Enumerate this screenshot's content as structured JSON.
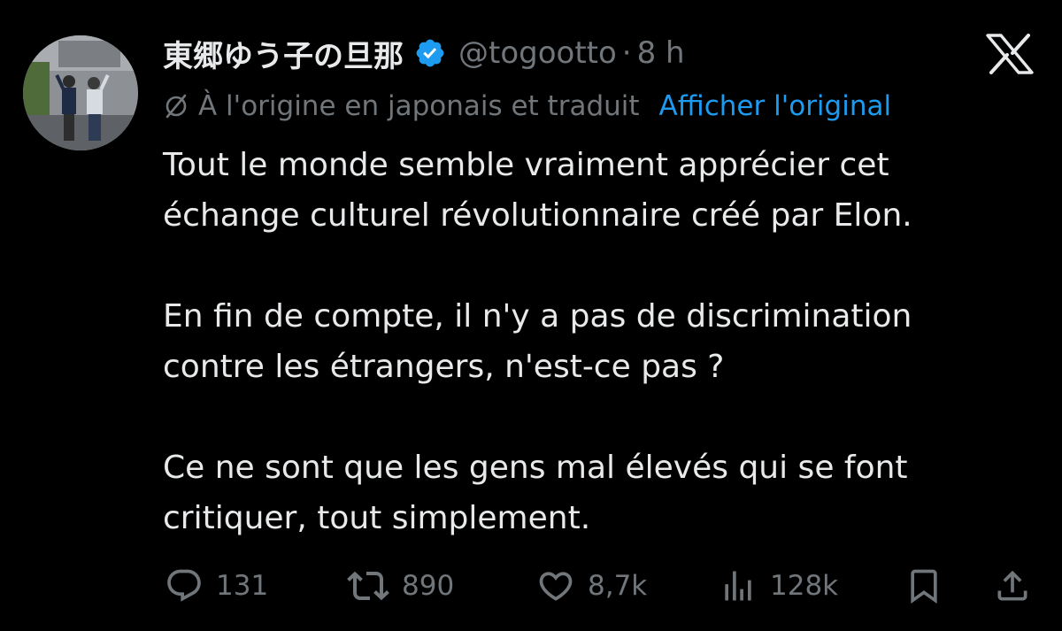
{
  "tweet": {
    "author": {
      "display_name": "東郷ゆう子の旦那",
      "handle": "@togootto",
      "separator": "·",
      "time": "8 h",
      "verified": true
    },
    "translation": {
      "note": "À l'origine en japonais et traduit",
      "show_original_label": "Afficher l'original"
    },
    "text_lines": [
      "Tout le monde semble vraiment apprécier cet",
      "échange culturel révolutionnaire créé par Elon.",
      "",
      "En fin de compte, il n'y a pas de discrimination",
      "contre les étrangers, n'est-ce pas ?",
      "",
      "Ce ne sont que les gens mal élevés qui se font",
      "critiquer, tout simplement."
    ],
    "actions": {
      "replies": "131",
      "reposts": "890",
      "likes": "8,7k",
      "views": "128k"
    }
  },
  "icons": {
    "verified": "verified-badge-icon",
    "logo": "x-logo-icon",
    "translate": "translate-icon",
    "reply": "reply-icon",
    "repost": "repost-icon",
    "like": "heart-icon",
    "views": "views-icon",
    "bookmark": "bookmark-icon",
    "share": "share-icon"
  },
  "colors": {
    "background": "#000000",
    "text": "#e7e9ea",
    "muted": "#71767b",
    "accent": "#1d9bf0"
  }
}
